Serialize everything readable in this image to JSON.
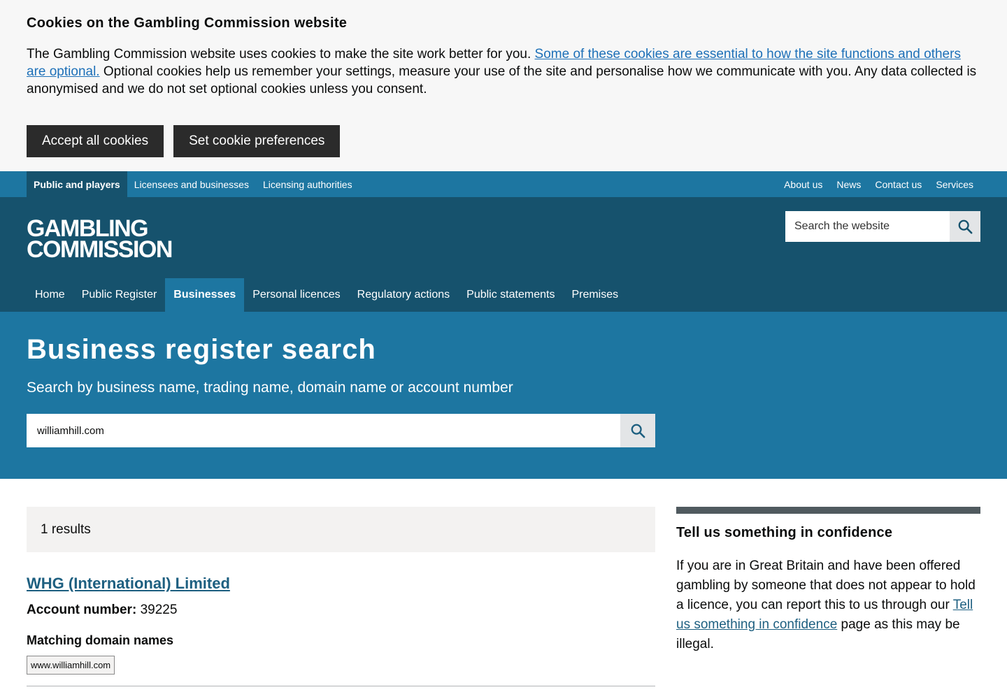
{
  "cookie_banner": {
    "title": "Cookies on the Gambling Commission website",
    "text_before": "The Gambling Commission website uses cookies to make the site work better for you. ",
    "link": "Some of these cookies are essential to how the site functions and others are optional.",
    "text_after": " Optional cookies help us remember your settings, measure your use of the site and personalise how we communicate with you. Any data collected is anonymised and we do not set optional cookies unless you consent.",
    "accept_label": "Accept all cookies",
    "prefs_label": "Set cookie preferences"
  },
  "audience_nav": {
    "left": [
      "Public and players",
      "Licensees and businesses",
      "Licensing authorities"
    ],
    "right": [
      "About us",
      "News",
      "Contact us",
      "Services"
    ]
  },
  "header": {
    "logo_line1": "GAMBLING",
    "logo_line2": "COMMISSION",
    "search_placeholder": "Search the website"
  },
  "main_nav": [
    "Home",
    "Public Register",
    "Businesses",
    "Personal licences",
    "Regulatory actions",
    "Public statements",
    "Premises"
  ],
  "hero": {
    "title": "Business register search",
    "subtitle": "Search by business name, trading name, domain name or account number",
    "search_value": "williamhill.com"
  },
  "results": {
    "count_label": "1 results",
    "items": [
      {
        "name": "WHG (International) Limited",
        "account_label": "Account number:",
        "account_number": "39225",
        "domains_heading": "Matching domain names",
        "domains": [
          "www.williamhill.com"
        ]
      }
    ]
  },
  "aside": {
    "title": "Tell us something in confidence",
    "text_before": "If you are in Great Britain and have been offered gambling by someone that does not appear to hold a licence, you can report this to us through our ",
    "link": "Tell us something in confidence",
    "text_after": " page as this may be illegal."
  },
  "colors": {
    "topbar": "#1d76a1",
    "header": "#16526d",
    "hero": "#1d76a1",
    "link": "#1d70b8"
  }
}
